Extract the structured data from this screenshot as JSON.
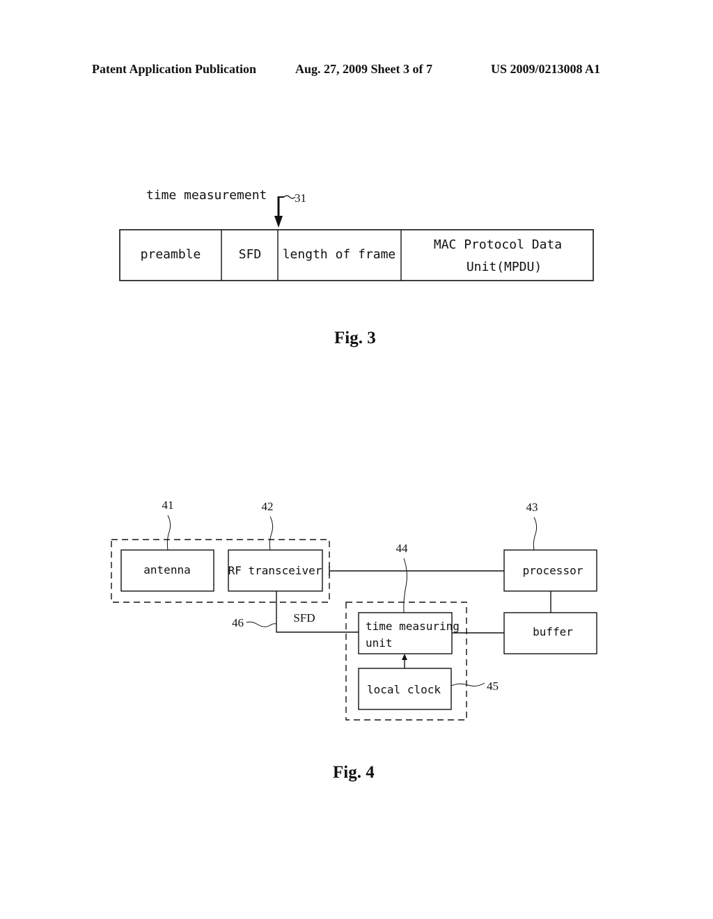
{
  "header": {
    "left": "Patent Application Publication",
    "center": "Aug. 27, 2009  Sheet 3 of 7",
    "right": "US 2009/0213008 A1"
  },
  "fig3": {
    "caption": "Fig. 3",
    "annotation": "time measurement",
    "ref": "31",
    "fields": [
      {
        "label": "preamble"
      },
      {
        "label": "SFD"
      },
      {
        "label": "length of frame"
      },
      {
        "label_line1": "MAC Protocol Data",
        "label_line2": "Unit(MPDU)"
      }
    ]
  },
  "fig4": {
    "caption": "Fig. 4",
    "blocks": {
      "antenna": {
        "label": "antenna",
        "ref": "41"
      },
      "rf": {
        "label": "RF transceiver",
        "ref": "42"
      },
      "processor": {
        "label": "processor",
        "ref": "43"
      },
      "tmu": {
        "label_line1": "time measuring",
        "label_line2": "unit",
        "ref": "44"
      },
      "clock": {
        "label": "local clock",
        "ref": "45"
      },
      "buffer": {
        "label": "buffer"
      }
    },
    "signal": {
      "label": "SFD",
      "ref": "46"
    }
  }
}
